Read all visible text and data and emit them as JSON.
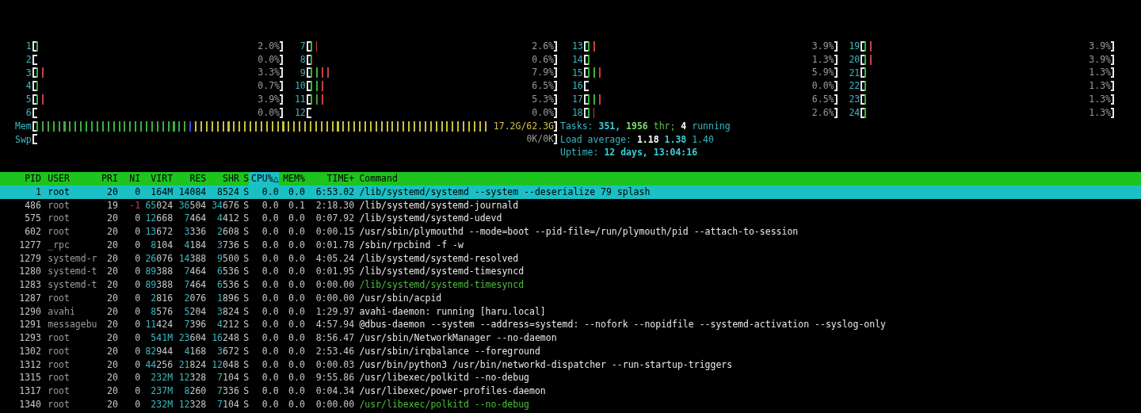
{
  "meters": [
    {
      "kind": "cpu",
      "label": "1",
      "level": 0.02,
      "reading": "2.0%"
    },
    {
      "kind": "cpu",
      "label": "2",
      "level": 0.0,
      "reading": "0.0%"
    },
    {
      "kind": "cpu",
      "label": "3",
      "level": 0.033,
      "reading": "3.3%"
    },
    {
      "kind": "cpu",
      "label": "4",
      "level": 0.007,
      "reading": "0.7%"
    },
    {
      "kind": "cpu",
      "label": "5",
      "level": 0.039,
      "reading": "3.9%"
    },
    {
      "kind": "cpu",
      "label": "6",
      "level": 0.0,
      "reading": "0.0%"
    },
    {
      "kind": "cpu",
      "label": "7",
      "level": 0.026,
      "reading": "2.6%"
    },
    {
      "kind": "cpu",
      "label": "8",
      "level": 0.006,
      "reading": "0.6%"
    },
    {
      "kind": "cpu",
      "label": "9",
      "level": 0.079,
      "reading": "7.9%"
    },
    {
      "kind": "cpu",
      "label": "10",
      "level": 0.065,
      "reading": "6.5%"
    },
    {
      "kind": "cpu",
      "label": "11",
      "level": 0.053,
      "reading": "5.3%"
    },
    {
      "kind": "cpu",
      "label": "12",
      "level": 0.0,
      "reading": "0.0%"
    },
    {
      "kind": "memory",
      "label": "Mem",
      "level": 0.87,
      "reading": "17.2G/62.3G"
    },
    {
      "kind": "swap",
      "label": "Swp",
      "level": 0.0,
      "reading": "0K/0K"
    },
    {
      "kind": "cpu",
      "label": "13",
      "level": 0.039,
      "reading": "3.9%"
    },
    {
      "kind": "cpu",
      "label": "14",
      "level": 0.013,
      "reading": "1.3%"
    },
    {
      "kind": "cpu",
      "label": "15",
      "level": 0.059,
      "reading": "5.9%"
    },
    {
      "kind": "cpu",
      "label": "16",
      "level": 0.0,
      "reading": "0.0%"
    },
    {
      "kind": "cpu",
      "label": "17",
      "level": 0.065,
      "reading": "6.5%"
    },
    {
      "kind": "cpu",
      "label": "18",
      "level": 0.026,
      "reading": "2.6%"
    },
    {
      "kind": "cpu",
      "label": "19",
      "level": 0.039,
      "reading": "3.9%"
    },
    {
      "kind": "cpu",
      "label": "20",
      "level": 0.039,
      "reading": "3.9%"
    },
    {
      "kind": "cpu",
      "label": "21",
      "level": 0.013,
      "reading": "1.3%"
    },
    {
      "kind": "cpu",
      "label": "22",
      "level": 0.013,
      "reading": "1.3%"
    },
    {
      "kind": "cpu",
      "label": "23",
      "level": 0.013,
      "reading": "1.3%"
    },
    {
      "kind": "cpu",
      "label": "24",
      "level": 0.013,
      "reading": "1.3%"
    }
  ],
  "summary": [
    {
      "label": "Tasks:",
      "parts": [
        {
          "text": "351,",
          "kind": "value"
        },
        {
          "text": "1956",
          "kind": "thread"
        },
        {
          "text": "thr;",
          "kind": "threadlabel"
        },
        {
          "text": "4",
          "kind": "bright"
        },
        {
          "text": "running",
          "kind": "label"
        }
      ]
    },
    {
      "label": "Load average:",
      "parts": [
        {
          "text": "1.18",
          "kind": "bright"
        },
        {
          "text": "1.38",
          "kind": "value"
        },
        {
          "text": "1.40",
          "kind": "label"
        }
      ]
    },
    {
      "label": "Uptime:",
      "parts": [
        {
          "text": "12 days, 13:04:16",
          "kind": "value"
        }
      ]
    }
  ],
  "table": {
    "columns": [
      {
        "label": "PID",
        "selected": false
      },
      {
        "label": "USER",
        "selected": false
      },
      {
        "label": "PRI",
        "selected": false
      },
      {
        "label": "NI",
        "selected": false
      },
      {
        "label": "VIRT",
        "selected": false
      },
      {
        "label": "RES",
        "selected": false
      },
      {
        "label": "SHR",
        "selected": false
      },
      {
        "label": "S",
        "selected": false
      },
      {
        "label": "CPU%△",
        "selected": true
      },
      {
        "label": "MEM%",
        "selected": false
      },
      {
        "label": "TIME+",
        "selected": false
      },
      {
        "label": "Command",
        "selected": false
      }
    ],
    "rows": [
      {
        "selected": true,
        "thread": false,
        "cells": [
          "1",
          "root",
          "20",
          "0",
          "164M",
          "14084",
          "8524",
          "S",
          "0.0",
          "0.0",
          "6:53.02",
          "/lib/systemd/systemd --system --deserialize 79 splash"
        ]
      },
      {
        "selected": false,
        "thread": false,
        "cells": [
          "486",
          "root",
          "19",
          "-1",
          "65024",
          "36504",
          "34676",
          "S",
          "0.0",
          "0.1",
          "2:18.30",
          "/lib/systemd/systemd-journald"
        ]
      },
      {
        "selected": false,
        "thread": false,
        "cells": [
          "575",
          "root",
          "20",
          "0",
          "12668",
          "7464",
          "4412",
          "S",
          "0.0",
          "0.0",
          "0:07.92",
          "/lib/systemd/systemd-udevd"
        ]
      },
      {
        "selected": false,
        "thread": false,
        "cells": [
          "602",
          "root",
          "20",
          "0",
          "13672",
          "3336",
          "2608",
          "S",
          "0.0",
          "0.0",
          "0:00.15",
          "/usr/sbin/plymouthd --mode=boot --pid-file=/run/plymouth/pid --attach-to-session"
        ]
      },
      {
        "selected": false,
        "thread": false,
        "cells": [
          "1277",
          "_rpc",
          "20",
          "0",
          "8104",
          "4184",
          "3736",
          "S",
          "0.0",
          "0.0",
          "0:01.78",
          "/sbin/rpcbind -f -w"
        ]
      },
      {
        "selected": false,
        "thread": false,
        "cells": [
          "1279",
          "systemd-r",
          "20",
          "0",
          "26076",
          "14388",
          "9500",
          "S",
          "0.0",
          "0.0",
          "4:05.24",
          "/lib/systemd/systemd-resolved"
        ]
      },
      {
        "selected": false,
        "thread": false,
        "cells": [
          "1280",
          "systemd-t",
          "20",
          "0",
          "89388",
          "7464",
          "6536",
          "S",
          "0.0",
          "0.0",
          "0:01.95",
          "/lib/systemd/systemd-timesyncd"
        ]
      },
      {
        "selected": false,
        "thread": true,
        "cells": [
          "1283",
          "systemd-t",
          "20",
          "0",
          "89388",
          "7464",
          "6536",
          "S",
          "0.0",
          "0.0",
          "0:00.00",
          "/lib/systemd/systemd-timesyncd"
        ]
      },
      {
        "selected": false,
        "thread": false,
        "cells": [
          "1287",
          "root",
          "20",
          "0",
          "2816",
          "2076",
          "1896",
          "S",
          "0.0",
          "0.0",
          "0:00.00",
          "/usr/sbin/acpid"
        ]
      },
      {
        "selected": false,
        "thread": false,
        "cells": [
          "1290",
          "avahi",
          "20",
          "0",
          "8576",
          "5204",
          "3824",
          "S",
          "0.0",
          "0.0",
          "1:29.97",
          "avahi-daemon: running [haru.local]"
        ]
      },
      {
        "selected": false,
        "thread": false,
        "cells": [
          "1291",
          "messagebu",
          "20",
          "0",
          "11424",
          "7396",
          "4212",
          "S",
          "0.0",
          "0.0",
          "4:57.94",
          "@dbus-daemon --system --address=systemd: --nofork --nopidfile --systemd-activation --syslog-only"
        ]
      },
      {
        "selected": false,
        "thread": false,
        "cells": [
          "1293",
          "root",
          "20",
          "0",
          "541M",
          "23604",
          "16248",
          "S",
          "0.0",
          "0.0",
          "8:56.47",
          "/usr/sbin/NetworkManager --no-daemon"
        ]
      },
      {
        "selected": false,
        "thread": false,
        "cells": [
          "1302",
          "root",
          "20",
          "0",
          "82944",
          "4168",
          "3672",
          "S",
          "0.0",
          "0.0",
          "2:53.46",
          "/usr/sbin/irqbalance --foreground"
        ]
      },
      {
        "selected": false,
        "thread": false,
        "cells": [
          "1312",
          "root",
          "20",
          "0",
          "44256",
          "21824",
          "12048",
          "S",
          "0.0",
          "0.0",
          "0:00.03",
          "/usr/bin/python3 /usr/bin/networkd-dispatcher --run-startup-triggers"
        ]
      },
      {
        "selected": false,
        "thread": false,
        "cells": [
          "1315",
          "root",
          "20",
          "0",
          "232M",
          "12328",
          "7104",
          "S",
          "0.0",
          "0.0",
          "9:55.86",
          "/usr/libexec/polkitd --no-debug"
        ]
      },
      {
        "selected": false,
        "thread": false,
        "cells": [
          "1317",
          "root",
          "20",
          "0",
          "237M",
          "8260",
          "7336",
          "S",
          "0.0",
          "0.0",
          "0:04.34",
          "/usr/libexec/power-profiles-daemon"
        ]
      },
      {
        "selected": false,
        "thread": true,
        "cells": [
          "1340",
          "root",
          "20",
          "0",
          "232M",
          "12328",
          "7104",
          "S",
          "0.0",
          "0.0",
          "0:00.00",
          "/usr/libexec/polkitd --no-debug"
        ]
      }
    ]
  }
}
